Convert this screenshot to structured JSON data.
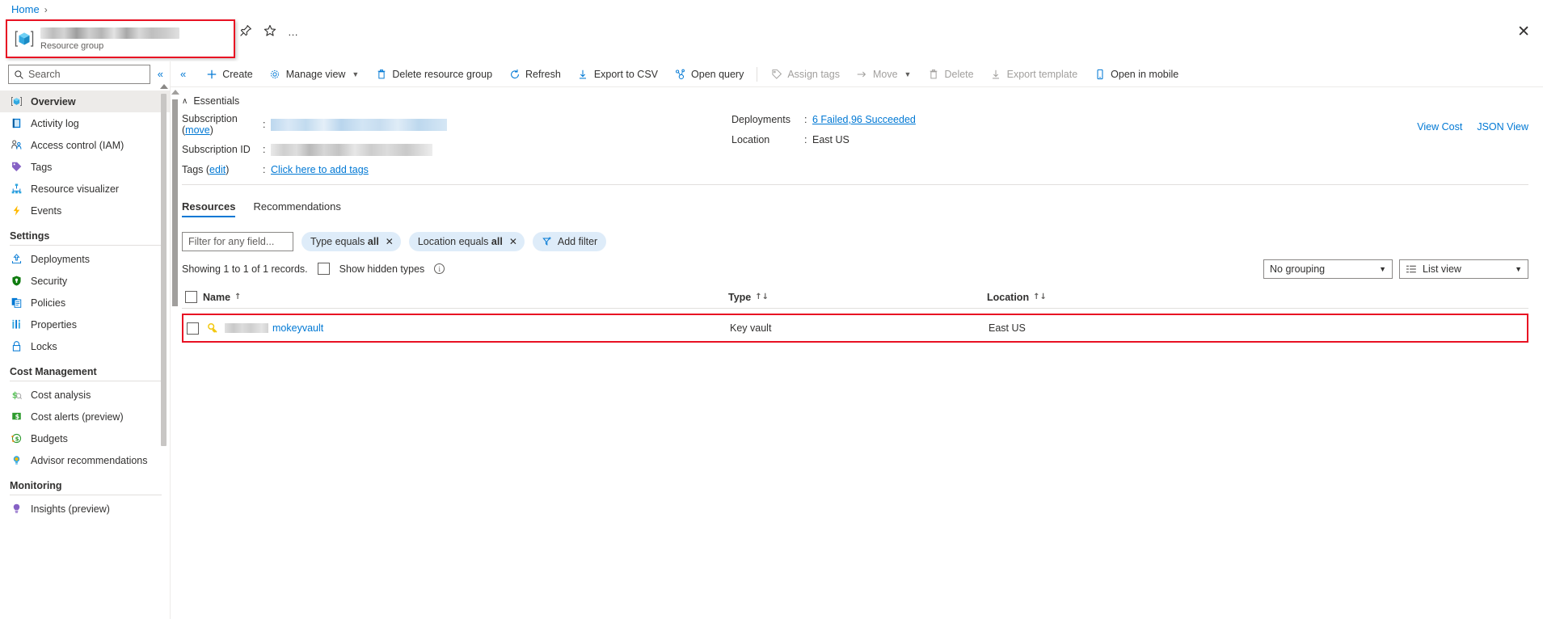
{
  "breadcrumb": {
    "home": "Home",
    "separator": "›"
  },
  "header": {
    "resource_name_redacted": true,
    "subtitle": "Resource group",
    "pin_label": "Pin",
    "favorite_label": "Favorite",
    "more_label": "…",
    "close_label": "✕"
  },
  "sidebar": {
    "search_placeholder": "Search",
    "collapse_label": "«",
    "items": [
      {
        "label": "Overview",
        "icon": "resource-group-icon",
        "active": true
      },
      {
        "label": "Activity log",
        "icon": "activity-log-icon",
        "active": false
      },
      {
        "label": "Access control (IAM)",
        "icon": "access-control-icon",
        "active": false
      },
      {
        "label": "Tags",
        "icon": "tags-icon",
        "active": false
      },
      {
        "label": "Resource visualizer",
        "icon": "resource-visualizer-icon",
        "active": false
      },
      {
        "label": "Events",
        "icon": "events-icon",
        "active": false
      }
    ],
    "sections": [
      {
        "title": "Settings",
        "items": [
          {
            "label": "Deployments",
            "icon": "deployments-icon"
          },
          {
            "label": "Security",
            "icon": "security-shield-icon"
          },
          {
            "label": "Policies",
            "icon": "policies-icon"
          },
          {
            "label": "Properties",
            "icon": "properties-icon"
          },
          {
            "label": "Locks",
            "icon": "lock-icon"
          }
        ]
      },
      {
        "title": "Cost Management",
        "items": [
          {
            "label": "Cost analysis",
            "icon": "cost-analysis-icon"
          },
          {
            "label": "Cost alerts (preview)",
            "icon": "cost-alerts-icon"
          },
          {
            "label": "Budgets",
            "icon": "budgets-icon"
          },
          {
            "label": "Advisor recommendations",
            "icon": "advisor-icon"
          }
        ]
      },
      {
        "title": "Monitoring",
        "items": [
          {
            "label": "Insights (preview)",
            "icon": "insights-icon"
          }
        ]
      }
    ]
  },
  "toolbar": {
    "collapse_label": "«",
    "buttons": [
      {
        "label": "Create",
        "icon": "plus-icon",
        "disabled": false,
        "chevron": false
      },
      {
        "label": "Manage view",
        "icon": "gear-icon",
        "disabled": false,
        "chevron": true
      },
      {
        "label": "Delete resource group",
        "icon": "trash-icon",
        "disabled": false,
        "chevron": false
      },
      {
        "label": "Refresh",
        "icon": "refresh-icon",
        "disabled": false,
        "chevron": false
      },
      {
        "label": "Export to CSV",
        "icon": "download-icon",
        "disabled": false,
        "chevron": false
      },
      {
        "label": "Open query",
        "icon": "query-icon",
        "disabled": false,
        "chevron": false
      },
      {
        "label": "Assign tags",
        "icon": "tag-icon",
        "disabled": true,
        "chevron": false
      },
      {
        "label": "Move",
        "icon": "arrow-right-icon",
        "disabled": true,
        "chevron": true
      },
      {
        "label": "Delete",
        "icon": "trash-icon",
        "disabled": true,
        "chevron": false
      },
      {
        "label": "Export template",
        "icon": "download-icon",
        "disabled": true,
        "chevron": false
      },
      {
        "label": "Open in mobile",
        "icon": "mobile-icon",
        "disabled": false,
        "chevron": false
      }
    ]
  },
  "essentials": {
    "title": "Essentials",
    "collapse_chevron": "∧",
    "left": {
      "subscription_label": "Subscription (",
      "subscription_move_link": "move",
      "subscription_label_close": ")",
      "subscription_value_redacted": true,
      "subscription_id_label": "Subscription ID",
      "subscription_id_redacted": true,
      "tags_label": "Tags (",
      "tags_edit_link": "edit",
      "tags_label_close": ")",
      "tags_value": "Click here to add tags"
    },
    "right": {
      "deployments_label": "Deployments",
      "deployments_value": "6 Failed,96 Succeeded",
      "location_label": "Location",
      "location_value": "East US"
    },
    "links": {
      "view_cost": "View Cost",
      "json_view": "JSON View"
    }
  },
  "tabs": [
    {
      "label": "Resources",
      "active": true
    },
    {
      "label": "Recommendations",
      "active": false
    }
  ],
  "filters": {
    "input_placeholder": "Filter for any field...",
    "chips": [
      {
        "prefix": "Type equals ",
        "value": "all",
        "close": "✕"
      },
      {
        "prefix": "Location equals ",
        "value": "all",
        "close": "✕"
      }
    ],
    "add_filter_label": "Add filter"
  },
  "list_controls": {
    "records_text": "Showing 1 to 1 of 1 records.",
    "show_hidden_label": "Show hidden types",
    "show_hidden_checked": false,
    "grouping_value": "No grouping",
    "view_value": "List view"
  },
  "table": {
    "columns": [
      {
        "label": "Name",
        "sort": "↑"
      },
      {
        "label": "Type",
        "sort": "↑↓"
      },
      {
        "label": "Location",
        "sort": "↑↓"
      }
    ],
    "rows": [
      {
        "name_redacted": true,
        "name": "mokeyvault",
        "type": "Key vault",
        "location": "East US",
        "icon": "key-vault-icon",
        "highlighted": true,
        "more_label": "…"
      }
    ]
  },
  "colors": {
    "accent": "#0078d4",
    "highlight_red": "#e81123",
    "chip_bg": "#deecf9",
    "text": "#323130",
    "muted": "#605e5c"
  }
}
